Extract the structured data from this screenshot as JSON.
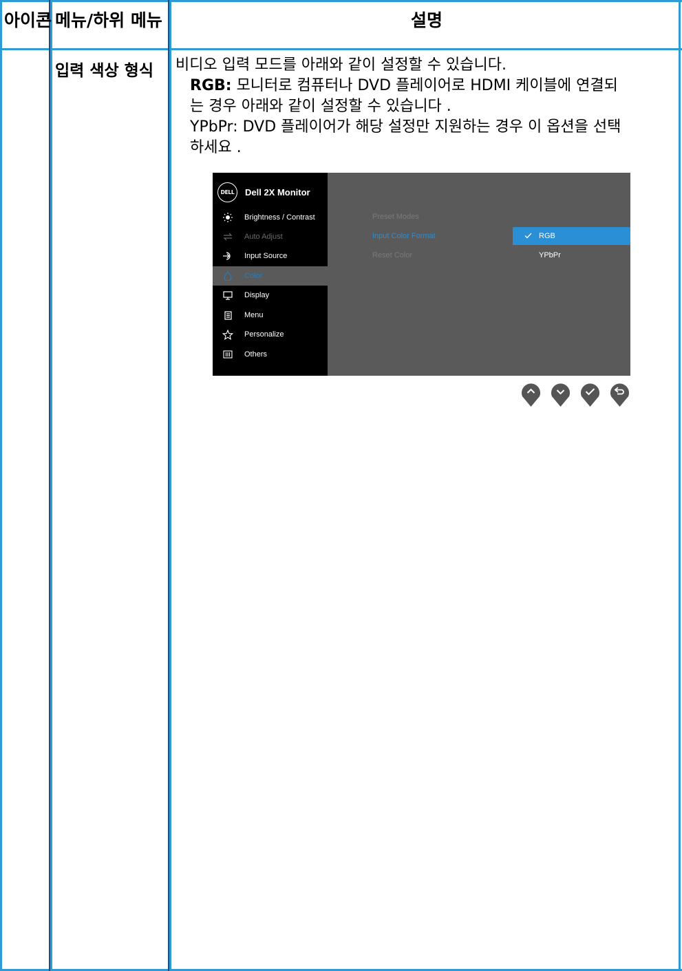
{
  "table": {
    "headers": {
      "icon": "아이콘",
      "menu": "메뉴/하위 메뉴",
      "description": "설명"
    },
    "row": {
      "menu_label": "입력 색상 형식",
      "desc_line1": "비디오 입력 모드를 아래와 같이 설정할 수 있습니다.",
      "rgb_label": "RGB:",
      "rgb_text_a": " 모니터로 컴퓨터나 DVD 플레이어로 HDMI 케이블에 연결되",
      "rgb_text_b": "는 경우 아래와 같이 설정할 수 있습니다 .",
      "ypbpr_text_a": "YPbPr: DVD 플레이어가 해당 설정만 지원하는 경우 이 옵션을 선택",
      "ypbpr_text_b": "하세요 ."
    }
  },
  "osd": {
    "logo_text": "DELL",
    "title": "Dell 2X Monitor",
    "menu": [
      {
        "label": "Brightness / Contrast",
        "icon": "brightness-icon",
        "state": "normal"
      },
      {
        "label": "Auto Adjust",
        "icon": "auto-adjust-icon",
        "state": "dim"
      },
      {
        "label": "Input Source",
        "icon": "input-source-icon",
        "state": "normal"
      },
      {
        "label": "Color",
        "icon": "color-icon",
        "state": "active"
      },
      {
        "label": "Display",
        "icon": "display-icon",
        "state": "normal"
      },
      {
        "label": "Menu",
        "icon": "menu-icon",
        "state": "normal"
      },
      {
        "label": "Personalize",
        "icon": "star-icon",
        "state": "normal"
      },
      {
        "label": "Others",
        "icon": "others-icon",
        "state": "normal"
      }
    ],
    "submenu": [
      {
        "label": "Preset Modes",
        "state": "dim"
      },
      {
        "label": "Input Color Format",
        "state": "highlight"
      },
      {
        "label": "Reset Color",
        "state": "dim"
      }
    ],
    "options": [
      {
        "label": "RGB",
        "selected": true
      },
      {
        "label": "YPbPr",
        "selected": false
      }
    ],
    "buttons": [
      "up-icon",
      "down-icon",
      "check-icon",
      "back-icon"
    ]
  },
  "colors": {
    "table_border": "#2e9ad6",
    "osd_bg": "#5a5a5a",
    "osd_left": "#000000",
    "accent": "#2a8fd4"
  }
}
